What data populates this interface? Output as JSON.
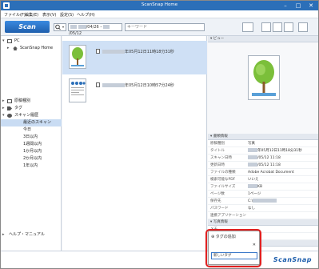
{
  "window": {
    "title": "ScanSnap Home",
    "minimize": "–",
    "maximize": "□",
    "close": "✕"
  },
  "menu": [
    "ファイル(F)",
    "編集(E)",
    "表示(V)",
    "設定(S)",
    "ヘルプ(H)"
  ],
  "toolbar": {
    "scan_label": "Scan",
    "date_from": "/04/26",
    "date_to": "/05/12",
    "search_placeholder": "キーワード"
  },
  "sidebar": {
    "items": [
      {
        "label": "PC",
        "indent": 0,
        "icon": "monitor-icon",
        "expanded": true
      },
      {
        "label": "ScanSnap Home",
        "indent": 1,
        "icon": "home-icon"
      },
      {
        "label": "原稿種別",
        "indent": 0,
        "icon": "folder-icon"
      },
      {
        "label": "タグ",
        "indent": 0,
        "icon": "tag-icon"
      },
      {
        "label": "スキャン履歴",
        "indent": 0,
        "icon": "history-icon",
        "expanded": true
      },
      {
        "label": "最近のスキャン",
        "indent": 1,
        "selected": true
      },
      {
        "label": "今日",
        "indent": 1
      },
      {
        "label": "3日以内",
        "indent": 1
      },
      {
        "label": "1週間以内",
        "indent": 1
      },
      {
        "label": "1か月以内",
        "indent": 1
      },
      {
        "label": "2か月以内",
        "indent": 1
      },
      {
        "label": "1年以内",
        "indent": 1
      }
    ],
    "help": "ヘルプ・マニュアル"
  },
  "list": {
    "rows": [
      {
        "text": "年05月12日11時18分31秒",
        "selected": true
      },
      {
        "text": "年05月12日10時57分24秒",
        "selected": false
      }
    ]
  },
  "preview": {
    "header": "ビュー"
  },
  "details": {
    "header": "書類情報",
    "props": [
      {
        "k": "原稿種別",
        "v": "写真"
      },
      {
        "k": "タイトル",
        "v": "年05月12日11時18分31秒"
      },
      {
        "k": "スキャン日時",
        "v": "/05/12 11:18"
      },
      {
        "k": "更新日時",
        "v": "/05/12 11:18"
      },
      {
        "k": "ファイルの種類",
        "v": "Adobe Acrobat Document"
      },
      {
        "k": "検索可能なPDF",
        "v": "いいえ"
      },
      {
        "k": "ファイルサイズ",
        "v": "KB"
      },
      {
        "k": "ページ数",
        "v": "1ページ"
      },
      {
        "k": "保存先",
        "v": "C:\\"
      },
      {
        "k": "パスワード",
        "v": "なし"
      },
      {
        "k": "連携アプリケーション",
        "v": ""
      }
    ]
  },
  "memo": {
    "header": "写真情報",
    "memo_label": "メモ",
    "photo_date": "写真日付"
  },
  "tags": {
    "header": "タグ"
  },
  "popup": {
    "title": "タグの追加",
    "close": "✕",
    "field_value": "新しいタグ"
  },
  "brand": "ScanSnap"
}
